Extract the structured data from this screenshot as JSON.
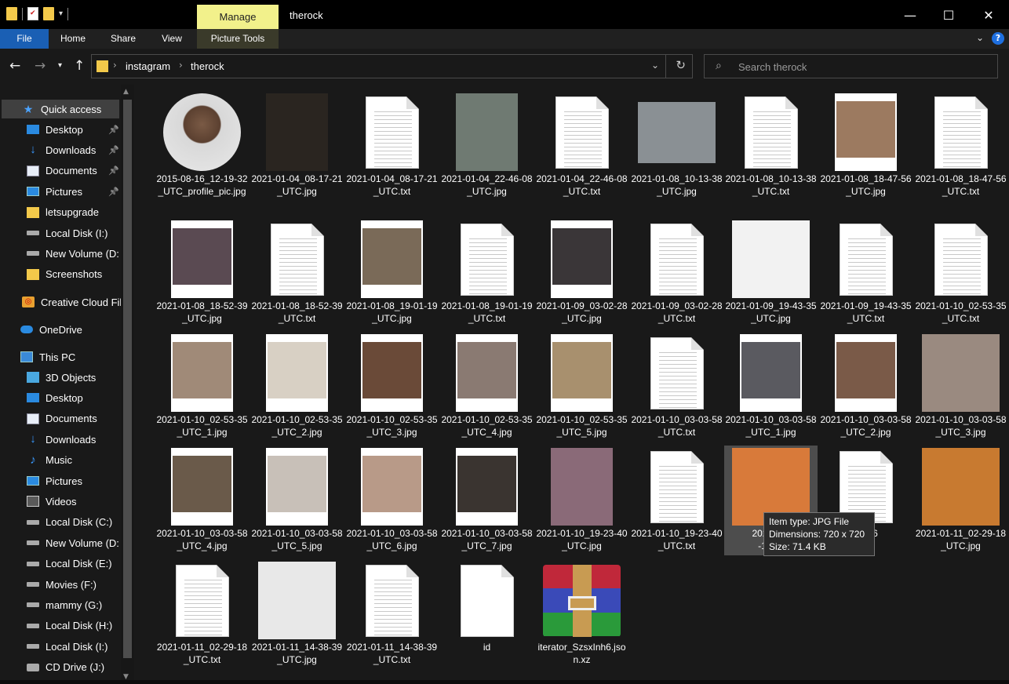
{
  "window": {
    "title": "therock",
    "manage_tab": "Manage",
    "minimize": "—",
    "maximize": "☐",
    "close": "✕"
  },
  "ribbon": {
    "tabs": [
      "File",
      "Home",
      "Share",
      "View",
      "Picture Tools"
    ],
    "help": "?"
  },
  "address": {
    "crumbs": [
      "instagram",
      "therock"
    ],
    "search_placeholder": "Search therock"
  },
  "nav": {
    "quick_access": "Quick access",
    "items": [
      {
        "label": "Desktop",
        "icon": "desktop-icon",
        "pinned": true
      },
      {
        "label": "Downloads",
        "icon": "download-icon",
        "pinned": true
      },
      {
        "label": "Documents",
        "icon": "documents-icon",
        "pinned": true
      },
      {
        "label": "Pictures",
        "icon": "pictures-icon",
        "pinned": true
      },
      {
        "label": "letsupgrade",
        "icon": "folder-icon",
        "pinned": false
      },
      {
        "label": "Local Disk (I:)",
        "icon": "drive-icon",
        "pinned": false
      },
      {
        "label": "New Volume (D:",
        "icon": "drive-icon",
        "pinned": false
      },
      {
        "label": "Screenshots",
        "icon": "folder-icon",
        "pinned": false
      }
    ],
    "creative_cloud": "Creative Cloud Fil",
    "onedrive": "OneDrive",
    "this_pc": "This PC",
    "pc_items": [
      {
        "label": "3D Objects",
        "icon": "3d-objects-icon"
      },
      {
        "label": "Desktop",
        "icon": "desktop-icon"
      },
      {
        "label": "Documents",
        "icon": "documents-icon"
      },
      {
        "label": "Downloads",
        "icon": "download-icon"
      },
      {
        "label": "Music",
        "icon": "music-icon"
      },
      {
        "label": "Pictures",
        "icon": "pictures-icon"
      },
      {
        "label": "Videos",
        "icon": "videos-icon"
      },
      {
        "label": "Local Disk (C:)",
        "icon": "drive-icon"
      },
      {
        "label": "New Volume (D:",
        "icon": "drive-icon"
      },
      {
        "label": "Local Disk (E:)",
        "icon": "drive-icon"
      },
      {
        "label": "Movies (F:)",
        "icon": "drive-icon"
      },
      {
        "label": "mammy (G:)",
        "icon": "drive-icon"
      },
      {
        "label": "Local Disk (H:)",
        "icon": "drive-icon"
      },
      {
        "label": "Local Disk (I:)",
        "icon": "drive-icon"
      },
      {
        "label": "CD Drive (J:)",
        "icon": "cd-drive-icon"
      }
    ]
  },
  "files": [
    {
      "name": "2015-08-16_12-19-32_UTC_profile_pic.jpg",
      "kind": "circle"
    },
    {
      "name": "2021-01-04_08-17-21_UTC.jpg",
      "kind": "photo",
      "color": "#2a2520"
    },
    {
      "name": "2021-01-04_08-17-21_UTC.txt",
      "kind": "txt"
    },
    {
      "name": "2021-01-04_22-46-08_UTC.jpg",
      "kind": "photo",
      "color": "#6f7a72"
    },
    {
      "name": "2021-01-04_22-46-08_UTC.txt",
      "kind": "txt"
    },
    {
      "name": "2021-01-08_10-13-38_UTC.jpg",
      "kind": "wide",
      "color": "#8a9094"
    },
    {
      "name": "2021-01-08_10-13-38_UTC.txt",
      "kind": "txt"
    },
    {
      "name": "2021-01-08_18-47-56_UTC.jpg",
      "kind": "post",
      "color": "#9c7a60"
    },
    {
      "name": "2021-01-08_18-47-56_UTC.txt",
      "kind": "txt"
    },
    {
      "name": "2021-01-08_18-52-39_UTC.jpg",
      "kind": "post",
      "color": "#5a4a52"
    },
    {
      "name": "2021-01-08_18-52-39_UTC.txt",
      "kind": "txt"
    },
    {
      "name": "2021-01-08_19-01-19_UTC.jpg",
      "kind": "post",
      "color": "#7a6a58"
    },
    {
      "name": "2021-01-08_19-01-19_UTC.txt",
      "kind": "txt"
    },
    {
      "name": "2021-01-09_03-02-28_UTC.jpg",
      "kind": "post",
      "color": "#3a3638"
    },
    {
      "name": "2021-01-09_03-02-28_UTC.txt",
      "kind": "txt"
    },
    {
      "name": "2021-01-09_19-43-35_UTC.jpg",
      "kind": "sq",
      "color": "#f2f2f2"
    },
    {
      "name": "2021-01-09_19-43-35_UTC.txt",
      "kind": "txt"
    },
    {
      "name": "2021-01-10_02-53-35_UTC.txt",
      "kind": "txt"
    },
    {
      "name": "2021-01-10_02-53-35_UTC_1.jpg",
      "kind": "post",
      "color": "#a08a78"
    },
    {
      "name": "2021-01-10_02-53-35_UTC_2.jpg",
      "kind": "post",
      "color": "#d8d0c4"
    },
    {
      "name": "2021-01-10_02-53-35_UTC_3.jpg",
      "kind": "post",
      "color": "#6a4a38"
    },
    {
      "name": "2021-01-10_02-53-35_UTC_4.jpg",
      "kind": "post",
      "color": "#8a7a72"
    },
    {
      "name": "2021-01-10_02-53-35_UTC_5.jpg",
      "kind": "post",
      "color": "#a8906e"
    },
    {
      "name": "2021-01-10_03-03-58_UTC.txt",
      "kind": "txt"
    },
    {
      "name": "2021-01-10_03-03-58_UTC_1.jpg",
      "kind": "post",
      "color": "#5a5a60"
    },
    {
      "name": "2021-01-10_03-03-58_UTC_2.jpg",
      "kind": "post",
      "color": "#7a5a48"
    },
    {
      "name": "2021-01-10_03-03-58_UTC_3.jpg",
      "kind": "sq",
      "color": "#9a8a80"
    },
    {
      "name": "2021-01-10_03-03-58_UTC_4.jpg",
      "kind": "post",
      "color": "#6a5a4a"
    },
    {
      "name": "2021-01-10_03-03-58_UTC_5.jpg",
      "kind": "post",
      "color": "#c8c0b8"
    },
    {
      "name": "2021-01-10_03-03-58_UTC_6.jpg",
      "kind": "post",
      "color": "#b89a88"
    },
    {
      "name": "2021-01-10_03-03-58_UTC_7.jpg",
      "kind": "post",
      "color": "#3a3430"
    },
    {
      "name": "2021-01-10_19-23-40_UTC.jpg",
      "kind": "photo",
      "color": "#8a6a78"
    },
    {
      "name": "2021-01-10_19-23-40_UTC.txt",
      "kind": "txt"
    },
    {
      "name": "2021-01-11_02-29-19_UTC.jpg",
      "kind": "sq",
      "color": "#d87a3a",
      "display": "2021-01-\n-19_U"
    },
    {
      "name": "2021-01-11_02-29-19_UTC.txt",
      "kind": "txt",
      "display": "01-06\nxt"
    },
    {
      "name": "2021-01-11_02-29-18_UTC.jpg",
      "kind": "sq",
      "color": "#c87a30"
    },
    {
      "name": "2021-01-11_02-29-18_UTC.txt",
      "kind": "txt"
    },
    {
      "name": "2021-01-11_14-38-39_UTC.jpg",
      "kind": "sq",
      "color": "#e8e8e8"
    },
    {
      "name": "2021-01-11_14-38-39_UTC.txt",
      "kind": "txt"
    },
    {
      "name": "id",
      "kind": "plain"
    },
    {
      "name": "iterator_SzsxInh6.json.xz",
      "kind": "rar"
    }
  ],
  "tooltip": {
    "line1": "Item type: JPG File",
    "line2": "Dimensions: 720 x 720",
    "line3": "Size: 71.4 KB"
  }
}
